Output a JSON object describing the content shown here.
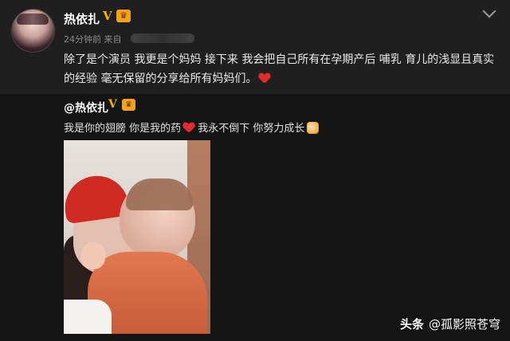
{
  "post": {
    "author": {
      "name": "热依扎",
      "verified_mark": "V",
      "vip_badge": "🎭"
    },
    "time": "24分钟前 来自",
    "content": "除了是个演员 我更是个妈妈 接下来 我会把自己所有在孕期产后 哺乳 育儿的浅显且真实的经验 毫无保留的分享给所有妈妈们。",
    "emoji": "heart"
  },
  "repost": {
    "author": {
      "name": "@热依扎",
      "verified_mark": "V",
      "vip_badge": "🎭"
    },
    "text_a": "我是你的翅膀 你是我的药",
    "text_b": " 我永不倒下 你努力成长",
    "photo": "mother-and-baby-photo"
  },
  "watermark": {
    "brand": "头条",
    "handle": "@孤影照苍穹"
  },
  "colors": {
    "background": "#1b1b1b",
    "repost_bg": "#151515",
    "vip_gold": "#f6b200",
    "heart": "#e02c2c"
  }
}
